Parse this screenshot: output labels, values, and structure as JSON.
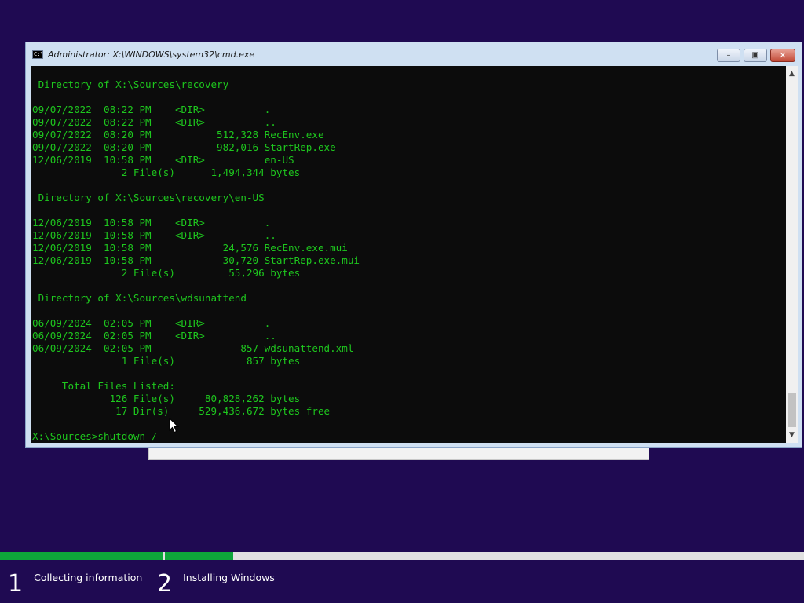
{
  "window": {
    "title": "Administrator: X:\\WINDOWS\\system32\\cmd.exe",
    "icon": "cmd-icon",
    "buttons": {
      "minimize": "minimize-icon",
      "restore": "restore-icon",
      "close": "close-icon"
    }
  },
  "console": {
    "text_color": "#1ec71e",
    "background": "#0c0c0c",
    "lines": [
      " Directory of X:\\Sources\\recovery",
      "",
      "09/07/2022  08:22 PM    <DIR>          .",
      "09/07/2022  08:22 PM    <DIR>          ..",
      "09/07/2022  08:20 PM           512,328 RecEnv.exe",
      "09/07/2022  08:20 PM           982,016 StartRep.exe",
      "12/06/2019  10:58 PM    <DIR>          en-US",
      "               2 File(s)      1,494,344 bytes",
      "",
      " Directory of X:\\Sources\\recovery\\en-US",
      "",
      "12/06/2019  10:58 PM    <DIR>          .",
      "12/06/2019  10:58 PM    <DIR>          ..",
      "12/06/2019  10:58 PM            24,576 RecEnv.exe.mui",
      "12/06/2019  10:58 PM            30,720 StartRep.exe.mui",
      "               2 File(s)         55,296 bytes",
      "",
      " Directory of X:\\Sources\\wdsunattend",
      "",
      "06/09/2024  02:05 PM    <DIR>          .",
      "06/09/2024  02:05 PM    <DIR>          ..",
      "06/09/2024  02:05 PM               857 wdsunattend.xml",
      "               1 File(s)            857 bytes",
      "",
      "     Total Files Listed:",
      "             126 File(s)     80,828,262 bytes",
      "              17 Dir(s)     529,436,672 bytes free",
      "",
      "X:\\Sources>shutdown /"
    ]
  },
  "setup_progress": {
    "accent": "#0ea63a",
    "steps": [
      {
        "number": "1",
        "label": "Collecting information",
        "progress": 1.0
      },
      {
        "number": "2",
        "label": "Installing Windows",
        "progress": 0.107
      }
    ]
  }
}
